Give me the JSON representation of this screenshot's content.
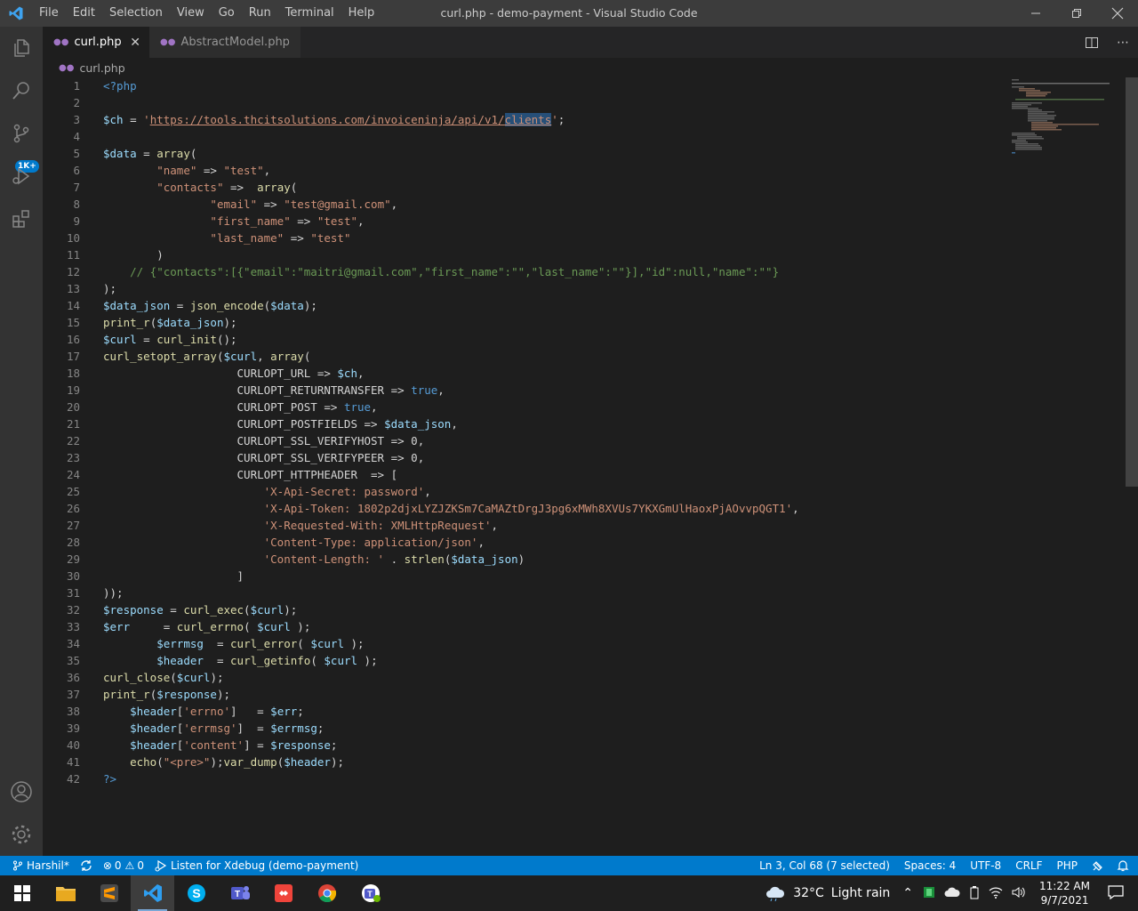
{
  "window": {
    "title": "curl.php - demo-payment - Visual Studio Code",
    "menu": [
      "File",
      "Edit",
      "Selection",
      "View",
      "Go",
      "Run",
      "Terminal",
      "Help"
    ]
  },
  "activity_bar": {
    "items": [
      "explorer-icon",
      "search-icon",
      "source-control-icon",
      "run-debug-icon",
      "extensions-icon"
    ],
    "scm_badge": "1K+",
    "bottom": [
      "accounts-icon",
      "manage-gear-icon"
    ]
  },
  "tabs": [
    {
      "label": "curl.php",
      "active": true
    },
    {
      "label": "AbstractModel.php",
      "active": false
    }
  ],
  "breadcrumb": "curl.php",
  "code_lines": [
    [
      [
        "kw",
        "<?php"
      ]
    ],
    [],
    [
      [
        "var",
        "$ch"
      ],
      [
        "plain",
        " = "
      ],
      [
        "str",
        "'"
      ],
      [
        "strlink",
        "https://tools.thcitsolutions.com/invoiceninja/api/v1/"
      ],
      [
        "sellink",
        "clients"
      ],
      [
        "str",
        "'"
      ],
      [
        "plain",
        ";"
      ]
    ],
    [],
    [
      [
        "var",
        "$data"
      ],
      [
        "plain",
        " = "
      ],
      [
        "fn",
        "array"
      ],
      [
        "plain",
        "("
      ]
    ],
    [
      [
        "plain",
        "        "
      ],
      [
        "str",
        "\"name\""
      ],
      [
        "plain",
        " => "
      ],
      [
        "str",
        "\"test\""
      ],
      [
        "plain",
        ","
      ]
    ],
    [
      [
        "plain",
        "        "
      ],
      [
        "str",
        "\"contacts\""
      ],
      [
        "plain",
        " =>  "
      ],
      [
        "fn",
        "array"
      ],
      [
        "plain",
        "("
      ]
    ],
    [
      [
        "plain",
        "                "
      ],
      [
        "str",
        "\"email\""
      ],
      [
        "plain",
        " => "
      ],
      [
        "str",
        "\"test@gmail.com\""
      ],
      [
        "plain",
        ","
      ]
    ],
    [
      [
        "plain",
        "                "
      ],
      [
        "str",
        "\"first_name\""
      ],
      [
        "plain",
        " => "
      ],
      [
        "str",
        "\"test\""
      ],
      [
        "plain",
        ","
      ]
    ],
    [
      [
        "plain",
        "                "
      ],
      [
        "str",
        "\"last_name\""
      ],
      [
        "plain",
        " => "
      ],
      [
        "str",
        "\"test\""
      ]
    ],
    [
      [
        "plain",
        "        )"
      ]
    ],
    [
      [
        "plain",
        "    "
      ],
      [
        "cm",
        "// {\"contacts\":[{\"email\":\"maitri@gmail.com\",\"first_name\":\"\",\"last_name\":\"\"}],\"id\":null,\"name\":\"\"}"
      ]
    ],
    [
      [
        "plain",
        ");"
      ]
    ],
    [
      [
        "var",
        "$data_json"
      ],
      [
        "plain",
        " = "
      ],
      [
        "fn",
        "json_encode"
      ],
      [
        "plain",
        "("
      ],
      [
        "var",
        "$data"
      ],
      [
        "plain",
        ");"
      ]
    ],
    [
      [
        "fn",
        "print_r"
      ],
      [
        "plain",
        "("
      ],
      [
        "var",
        "$data_json"
      ],
      [
        "plain",
        ");"
      ]
    ],
    [
      [
        "var",
        "$curl"
      ],
      [
        "plain",
        " = "
      ],
      [
        "fn",
        "curl_init"
      ],
      [
        "plain",
        "();"
      ]
    ],
    [
      [
        "fn",
        "curl_setopt_array"
      ],
      [
        "plain",
        "("
      ],
      [
        "var",
        "$curl"
      ],
      [
        "plain",
        ", "
      ],
      [
        "fn",
        "array"
      ],
      [
        "plain",
        "("
      ]
    ],
    [
      [
        "plain",
        "                    CURLOPT_URL => "
      ],
      [
        "var",
        "$ch"
      ],
      [
        "plain",
        ","
      ]
    ],
    [
      [
        "plain",
        "                    CURLOPT_RETURNTRANSFER => "
      ],
      [
        "kw",
        "true"
      ],
      [
        "plain",
        ","
      ]
    ],
    [
      [
        "plain",
        "                    CURLOPT_POST => "
      ],
      [
        "kw",
        "true"
      ],
      [
        "plain",
        ","
      ]
    ],
    [
      [
        "plain",
        "                    CURLOPT_POSTFIELDS => "
      ],
      [
        "var",
        "$data_json"
      ],
      [
        "plain",
        ","
      ]
    ],
    [
      [
        "plain",
        "                    CURLOPT_SSL_VERIFYHOST => 0,"
      ]
    ],
    [
      [
        "plain",
        "                    CURLOPT_SSL_VERIFYPEER => 0,"
      ]
    ],
    [
      [
        "plain",
        "                    CURLOPT_HTTPHEADER  => ["
      ]
    ],
    [
      [
        "plain",
        "                        "
      ],
      [
        "str",
        "'X-Api-Secret: password'"
      ],
      [
        "plain",
        ","
      ]
    ],
    [
      [
        "plain",
        "                        "
      ],
      [
        "str",
        "'X-Api-Token: 1802p2djxLYZJZKSm7CaMAZtDrgJ3pg6xMWh8XVUs7YKXGmUlHaoxPjAOvvpQGT1'"
      ],
      [
        "plain",
        ","
      ]
    ],
    [
      [
        "plain",
        "                        "
      ],
      [
        "str",
        "'X-Requested-With: XMLHttpRequest'"
      ],
      [
        "plain",
        ","
      ]
    ],
    [
      [
        "plain",
        "                        "
      ],
      [
        "str",
        "'Content-Type: application/json'"
      ],
      [
        "plain",
        ","
      ]
    ],
    [
      [
        "plain",
        "                        "
      ],
      [
        "str",
        "'Content-Length: '"
      ],
      [
        "plain",
        " . "
      ],
      [
        "fn",
        "strlen"
      ],
      [
        "plain",
        "("
      ],
      [
        "var",
        "$data_json"
      ],
      [
        "plain",
        ")"
      ]
    ],
    [
      [
        "plain",
        "                    ]"
      ]
    ],
    [
      [
        "plain",
        "));"
      ]
    ],
    [
      [
        "var",
        "$response"
      ],
      [
        "plain",
        " = "
      ],
      [
        "fn",
        "curl_exec"
      ],
      [
        "plain",
        "("
      ],
      [
        "var",
        "$curl"
      ],
      [
        "plain",
        ");"
      ]
    ],
    [
      [
        "var",
        "$err"
      ],
      [
        "plain",
        "     = "
      ],
      [
        "fn",
        "curl_errno"
      ],
      [
        "plain",
        "( "
      ],
      [
        "var",
        "$curl"
      ],
      [
        "plain",
        " );"
      ]
    ],
    [
      [
        "plain",
        "        "
      ],
      [
        "var",
        "$errmsg"
      ],
      [
        "plain",
        "  = "
      ],
      [
        "fn",
        "curl_error"
      ],
      [
        "plain",
        "( "
      ],
      [
        "var",
        "$curl"
      ],
      [
        "plain",
        " );"
      ]
    ],
    [
      [
        "plain",
        "        "
      ],
      [
        "var",
        "$header"
      ],
      [
        "plain",
        "  = "
      ],
      [
        "fn",
        "curl_getinfo"
      ],
      [
        "plain",
        "( "
      ],
      [
        "var",
        "$curl"
      ],
      [
        "plain",
        " );"
      ]
    ],
    [
      [
        "fn",
        "curl_close"
      ],
      [
        "plain",
        "("
      ],
      [
        "var",
        "$curl"
      ],
      [
        "plain",
        ");"
      ]
    ],
    [
      [
        "fn",
        "print_r"
      ],
      [
        "plain",
        "("
      ],
      [
        "var",
        "$response"
      ],
      [
        "plain",
        ");"
      ]
    ],
    [
      [
        "plain",
        "    "
      ],
      [
        "var",
        "$header"
      ],
      [
        "plain",
        "["
      ],
      [
        "str",
        "'errno'"
      ],
      [
        "plain",
        "]   = "
      ],
      [
        "var",
        "$err"
      ],
      [
        "plain",
        ";"
      ]
    ],
    [
      [
        "plain",
        "    "
      ],
      [
        "var",
        "$header"
      ],
      [
        "plain",
        "["
      ],
      [
        "str",
        "'errmsg'"
      ],
      [
        "plain",
        "]  = "
      ],
      [
        "var",
        "$errmsg"
      ],
      [
        "plain",
        ";"
      ]
    ],
    [
      [
        "plain",
        "    "
      ],
      [
        "var",
        "$header"
      ],
      [
        "plain",
        "["
      ],
      [
        "str",
        "'content'"
      ],
      [
        "plain",
        "] = "
      ],
      [
        "var",
        "$response"
      ],
      [
        "plain",
        ";"
      ]
    ],
    [
      [
        "plain",
        "    "
      ],
      [
        "fn",
        "echo"
      ],
      [
        "plain",
        "("
      ],
      [
        "str",
        "\"<pre>\""
      ],
      [
        "plain",
        ");"
      ],
      [
        "fn",
        "var_dump"
      ],
      [
        "plain",
        "("
      ],
      [
        "var",
        "$header"
      ],
      [
        "plain",
        ");"
      ]
    ],
    [
      [
        "kw",
        "?>"
      ]
    ]
  ],
  "status_bar": {
    "branch": "Harshil*",
    "errors": "0",
    "warnings": "0",
    "debug_label": "Listen for Xdebug (demo-payment)",
    "cursor": "Ln 3, Col 68 (7 selected)",
    "spaces": "Spaces: 4",
    "encoding": "UTF-8",
    "eol": "CRLF",
    "language": "PHP"
  },
  "taskbar": {
    "apps": [
      "start-icon",
      "file-explorer-icon",
      "sublime-text-icon",
      "vscode-icon",
      "skype-icon",
      "teams-icon",
      "anydesk-icon",
      "chrome-icon",
      "teams-personal-icon"
    ],
    "weather_temp": "32°C",
    "weather_desc": "Light rain",
    "time": "11:22 AM",
    "date": "9/7/2021"
  },
  "colors": {
    "accent": "#007acc",
    "keyword": "#569cd6",
    "variable": "#9cdcfe",
    "function": "#dcdcaa",
    "string": "#ce9178",
    "comment": "#6a9955"
  }
}
